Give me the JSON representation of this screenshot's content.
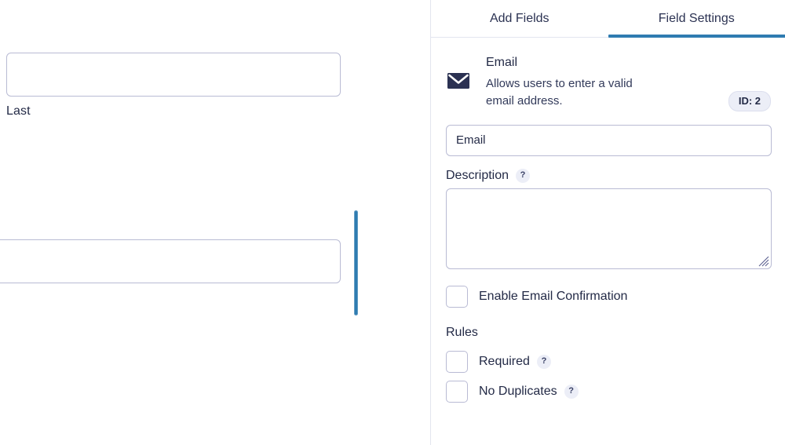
{
  "colors": {
    "accent": "#2f7cb1",
    "text": "#232a46",
    "border": "#b9bbd4",
    "badge_bg": "#eceef7",
    "divider": "#e3e5ef",
    "icon_navy": "#2b3152"
  },
  "form_preview": {
    "first_input_value": "",
    "first_input_placeholder": "",
    "sublabel_last": "Last",
    "second_input_value": "",
    "second_input_placeholder": "",
    "drop_indicator_name": "field-drop-indicator"
  },
  "settings_panel": {
    "tabs": [
      {
        "label": "Add Fields",
        "active": false,
        "name": "tab-add-fields"
      },
      {
        "label": "Field Settings",
        "active": true,
        "name": "tab-field-settings"
      }
    ],
    "field_header": {
      "icon": "envelope-icon",
      "type_name": "Email",
      "description": "Allows users to enter a valid email address.",
      "id_badge": "ID: 2"
    },
    "label_field": {
      "value": "Email",
      "placeholder": "Email"
    },
    "description_field": {
      "label": "Description",
      "help_icon": "?",
      "value": "",
      "placeholder": ""
    },
    "email_confirmation": {
      "label": "Enable Email Confirmation",
      "checked": false
    },
    "rules": {
      "heading": "Rules",
      "items": [
        {
          "label": "Required",
          "help_icon": "?",
          "checked": false
        },
        {
          "label": "No Duplicates",
          "help_icon": "?",
          "checked": false
        }
      ]
    }
  }
}
